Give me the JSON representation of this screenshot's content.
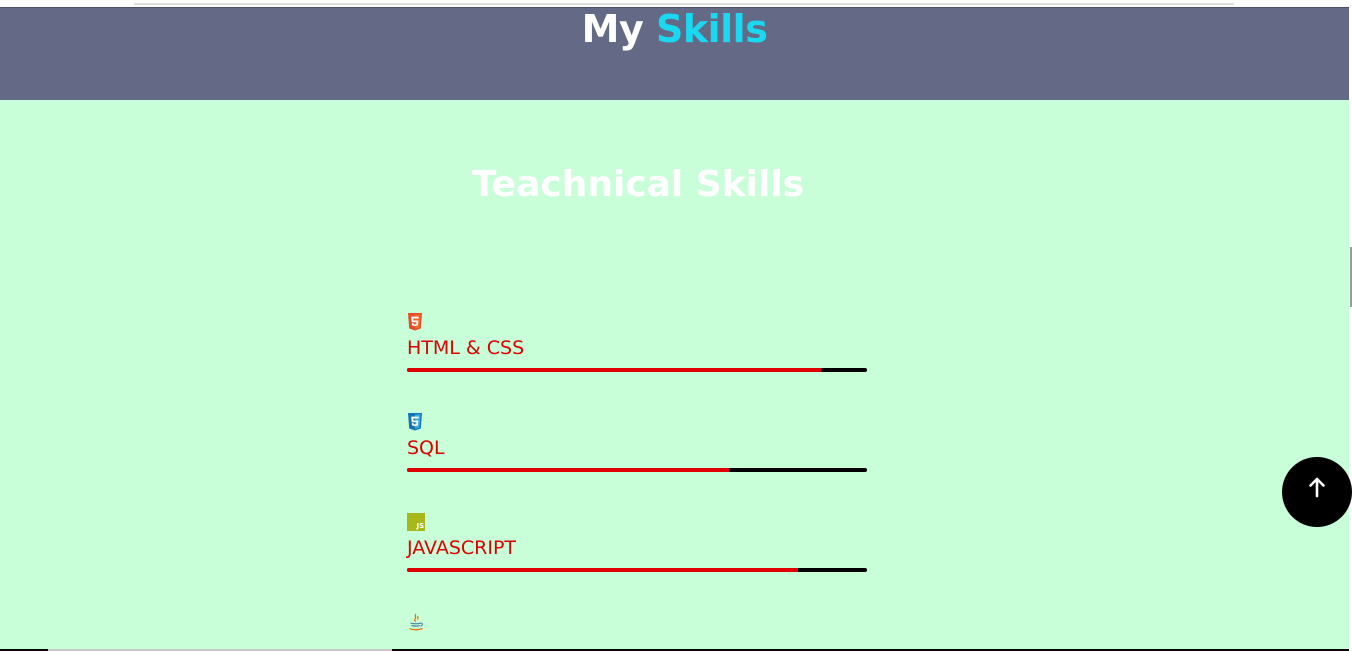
{
  "header": {
    "title_word1": "My",
    "title_word2": "Skills"
  },
  "section": {
    "title": "Teachnical Skills"
  },
  "skills": [
    {
      "label": "HTML & CSS",
      "icon": "html5-icon",
      "level_percent": 90
    },
    {
      "label": "SQL",
      "icon": "css3-icon",
      "level_percent": 70
    },
    {
      "label": "JAVASCRIPT",
      "icon": "javascript-icon",
      "level_percent": 85
    },
    {
      "label": "",
      "icon": "java-icon"
    }
  ],
  "colors": {
    "header_bg": "#646a85",
    "accent": "#1ad8f0",
    "page_bg": "#c8ffd8",
    "skill_text": "#dd0000",
    "bar_fill": "#e00000",
    "bar_track": "#000000",
    "back_to_top_bg": "#000000"
  },
  "back_to_top": {
    "icon": "arrow-up-icon"
  }
}
